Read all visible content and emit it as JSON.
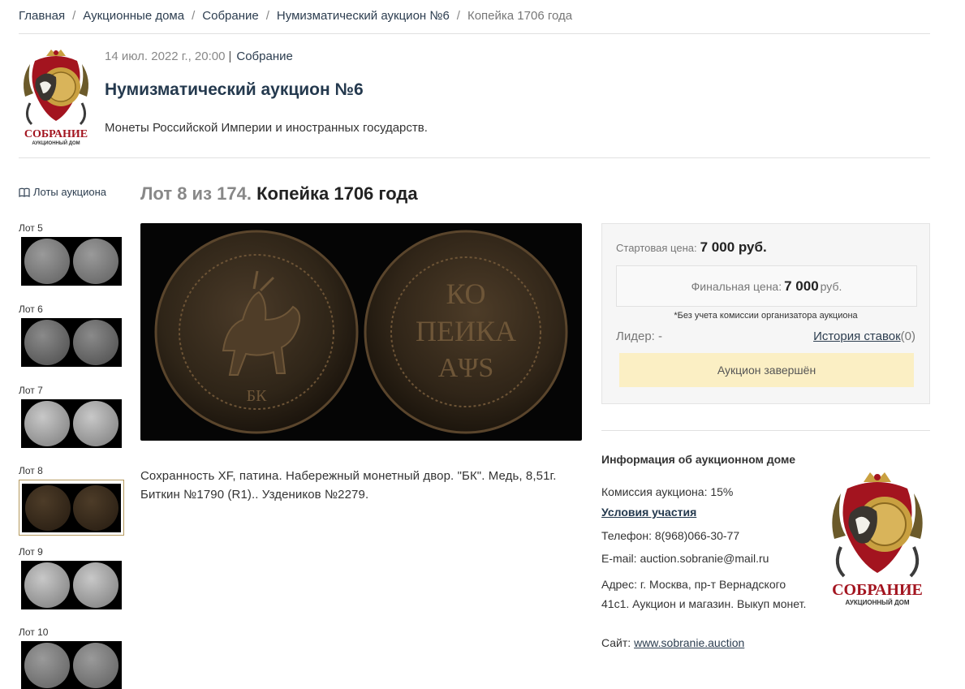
{
  "breadcrumb": [
    {
      "label": "Главная"
    },
    {
      "label": "Аукционные дома"
    },
    {
      "label": "Собрание"
    },
    {
      "label": "Нумизматический аукцион №6"
    }
  ],
  "breadcrumb_current": "Копейка 1706 года",
  "separator": "/",
  "auction": {
    "date": "14 июл. 2022 г., 20:00",
    "pipe": "|",
    "house": "Собрание",
    "title": "Нумизматический аукцион №6",
    "description": "Монеты Российской Империи и иностранных государств."
  },
  "logo": {
    "name": "СОБРАНИЕ",
    "subtitle": "АУКЦИОННЫЙ ДОМ",
    "brand_color": "#a3141f",
    "gold": "#c9a040"
  },
  "sidebar": {
    "lots_link": "Лоты аукциона",
    "lots": [
      {
        "label": "Лот 5",
        "tone": "silver"
      },
      {
        "label": "Лот 6",
        "tone": "silver-dark"
      },
      {
        "label": "Лот 7",
        "tone": "silver-light"
      },
      {
        "label": "Лот 8",
        "tone": "copper",
        "active": true
      },
      {
        "label": "Лот 9",
        "tone": "silver-light"
      },
      {
        "label": "Лот 10",
        "tone": "silver"
      }
    ]
  },
  "lot": {
    "number_text": "Лот 8 из 174.",
    "title": "Копейка 1706 года",
    "description": "Сохранность XF, патина. Набережный монетный двор. \"БК\". Медь, 8,51г. Биткин №1790 (R1).. Уздеников №2279.",
    "coin_obverse_text": "БК",
    "coin_reverse_lines": [
      "КО",
      "ПЕИКА",
      "АΨS"
    ]
  },
  "price": {
    "start_label": "Стартовая цена:",
    "start_value": "7 000 руб.",
    "final_label": "Финальная цена:",
    "final_value": "7 000",
    "final_currency": "руб.",
    "note": "*Без учета комиссии организатора аукциона",
    "leader_label": "Лидер:",
    "leader_value": "-",
    "history_label": "История ставок",
    "history_count": "(0)",
    "status_button": "Аукцион завершён"
  },
  "house_info": {
    "title": "Информация об аукционном доме",
    "commission": "Комиссия аукциона: 15%",
    "terms": "Условия участия",
    "phone": "Телефон: 8(968)066-30-77",
    "email": "E-mail: auction.sobranie@mail.ru",
    "address": "Адрес: г. Москва, пр-т Вернадского 41с1. Аукцион и магазин. Выкуп монет.",
    "site_label": "Сайт:",
    "site": "www.sobranie.auction"
  }
}
